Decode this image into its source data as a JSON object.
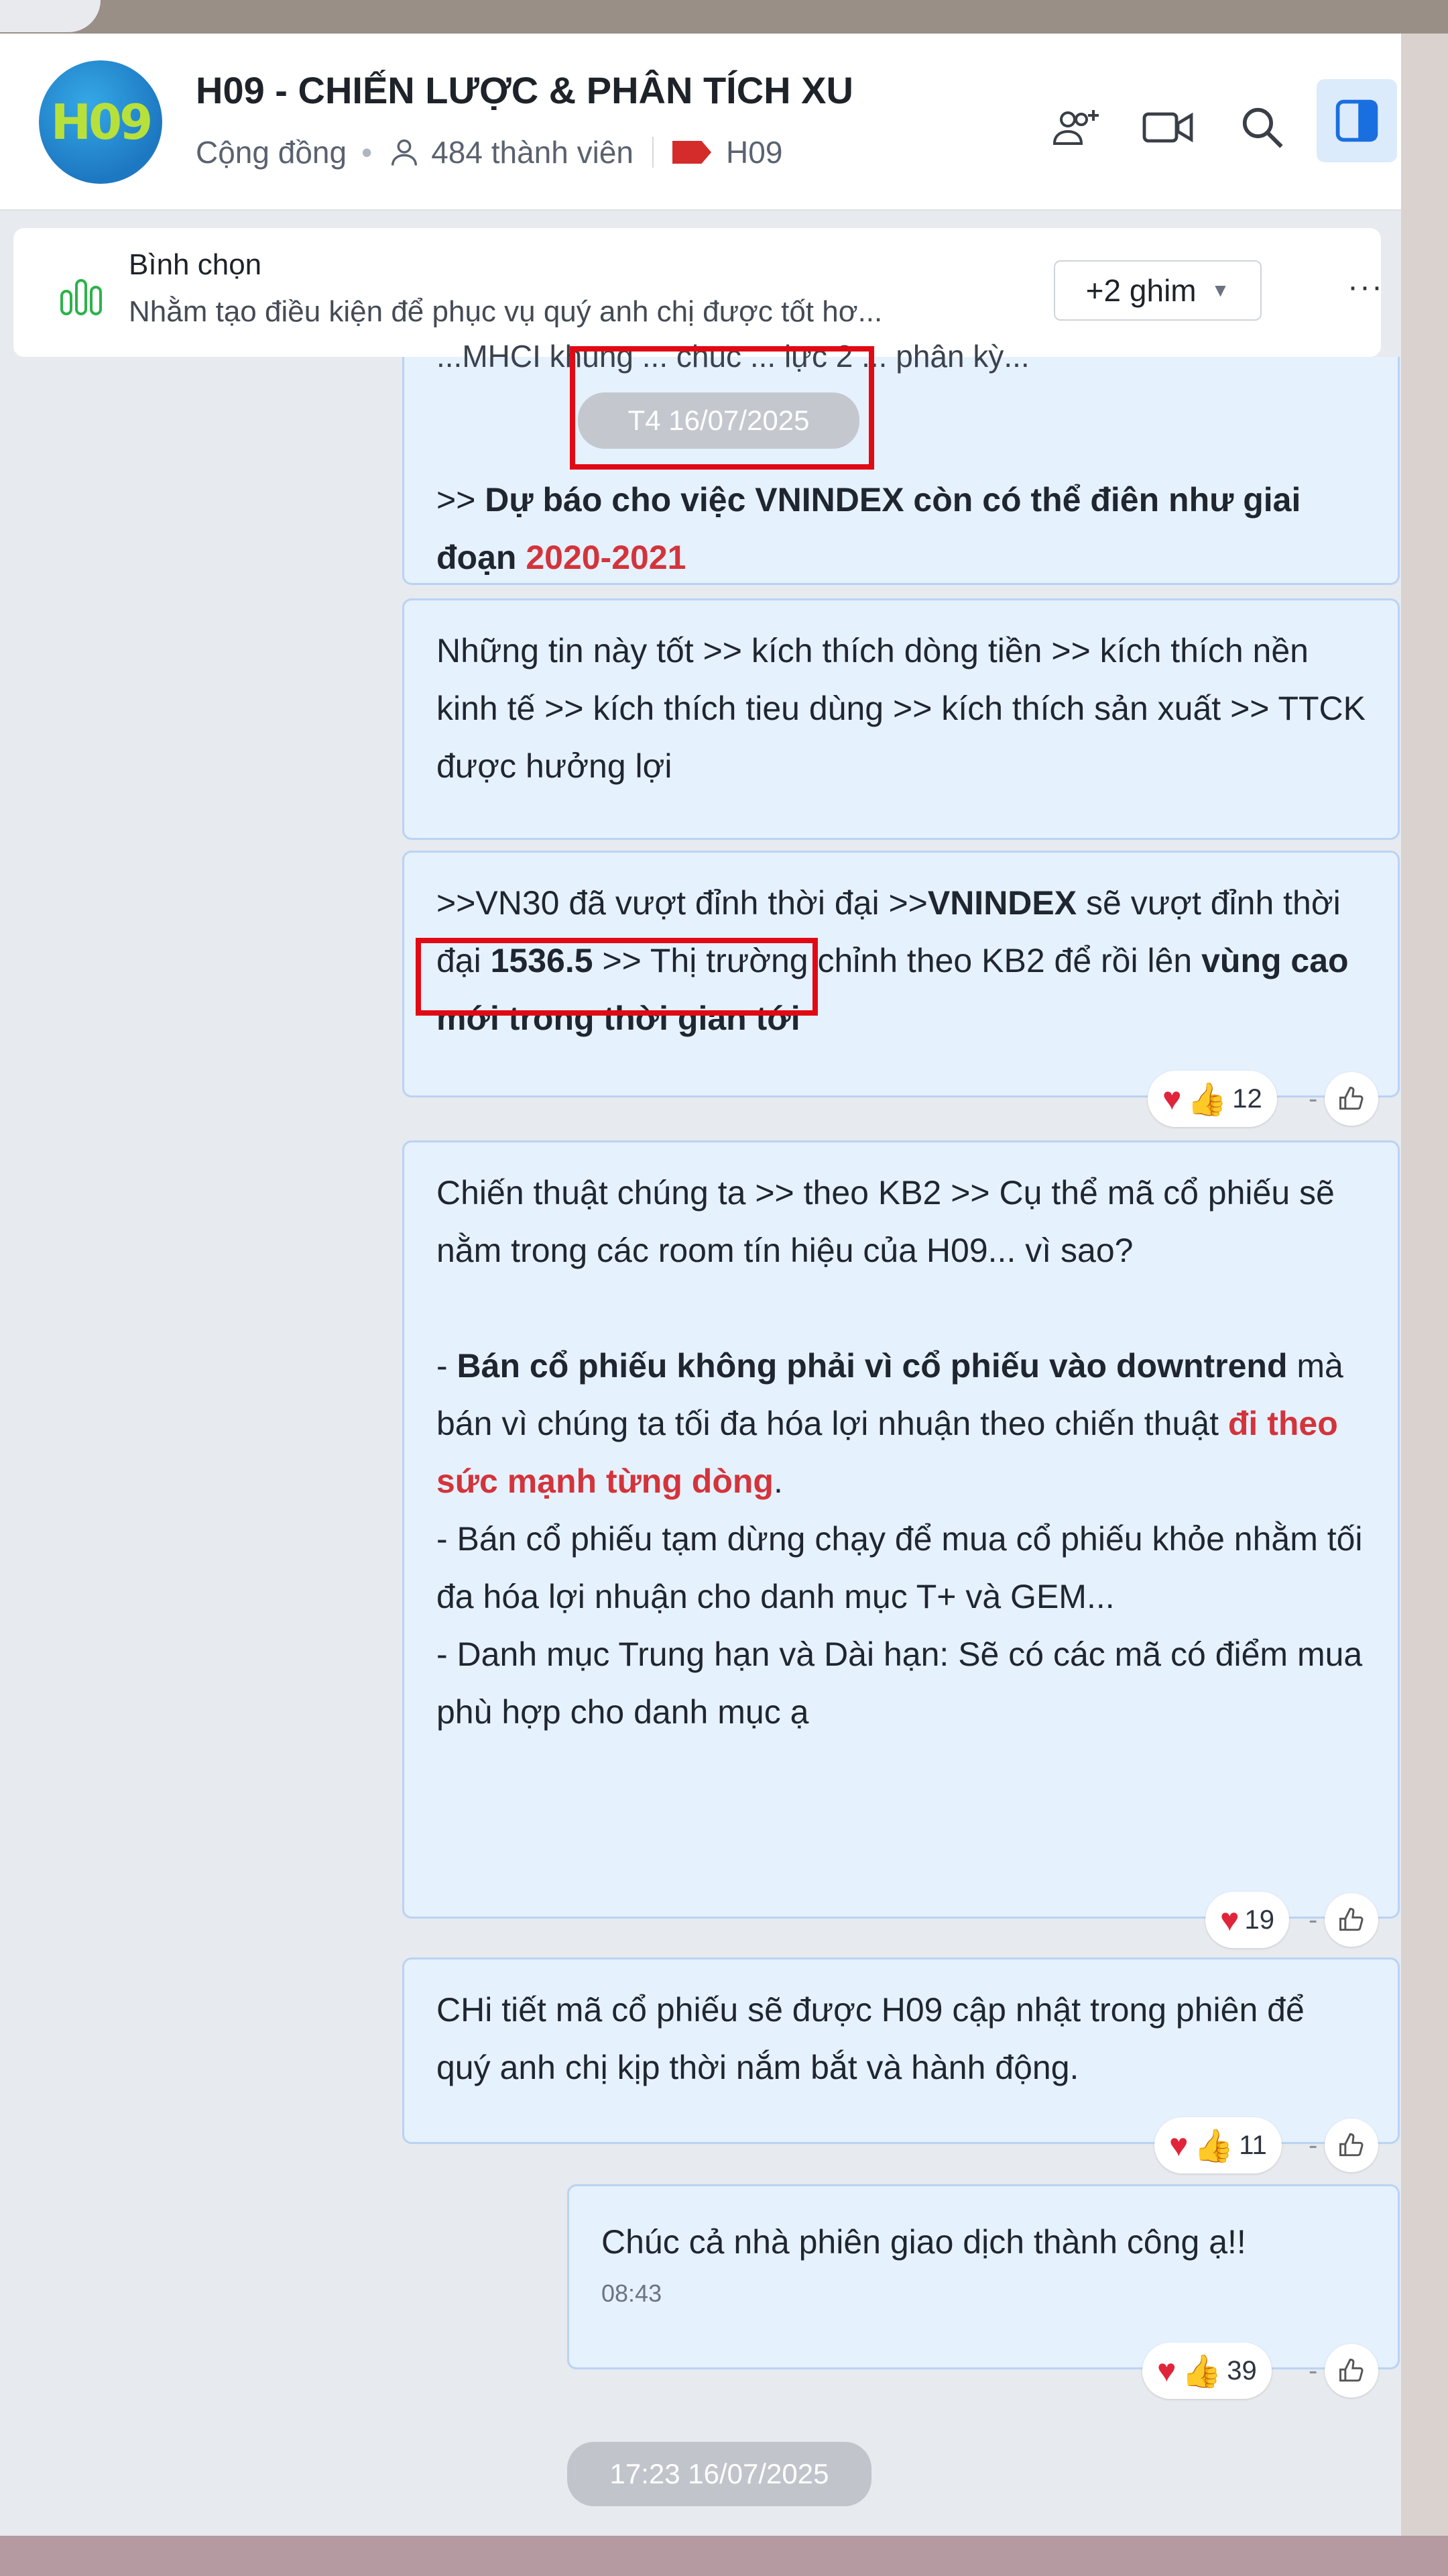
{
  "header": {
    "logo_text": "H09",
    "title": "H09 - CHIẾN LƯỢC & PHÂN TÍCH XU",
    "community": "Cộng đồng",
    "members": "484 thành viên",
    "tag": "H09"
  },
  "pinned": {
    "title": "Bình chọn",
    "preview": "Nhằm tạo điều kiện để phục vụ quý anh chị được tốt hơ...",
    "ghim_label": "+2 ghim",
    "more_label": "···"
  },
  "messages": {
    "m1": {
      "date_chip": "T4 16/07/2025",
      "partial_top": "...MHCI khung ... chuc ... lực 2 ... phân kỳ...",
      "prefix": ">> ",
      "bold": "Dự báo cho việc VNINDEX còn có thể điên như giai đoạn ",
      "red": "2020-2021"
    },
    "m2": {
      "text": "Những tin này tốt >> kích thích dòng tiền >> kích thích nền kinh tế >> kích thích tieu dùng >> kích thích sản xuất >> TTCK được hưởng lợi"
    },
    "m3": {
      "p1": ">>VN30 đã vượt đỉnh thời đại >>",
      "b1": "VNINDEX",
      "p2": " sẽ vượt đỉnh thời đại ",
      "b2": "1536.5",
      "p3": " >> Thị trường chỉnh theo KB2 để rồi lên ",
      "b3": "vùng cao mới trong thời gian tới",
      "reaction_count": "12"
    },
    "m4": {
      "intro": "Chiến thuật chúng ta >> theo KB2 >> Cụ thể mã cổ phiếu sẽ nằm trong các room tín hiệu của H09... vì sao?",
      "l1_prefix": "- ",
      "l1_b1": "Bán cổ phiếu không phải vì cổ phiếu vào downtrend",
      "l1_mid": " mà bán vì chúng ta tối đa hóa lợi nhuận theo chiến thuật ",
      "l1_red": "đi theo sức mạnh từng dòng",
      "l1_end": ".",
      "l2": "- Bán cổ phiếu tạm dừng chạy để mua cổ phiếu khỏe nhằm tối đa hóa lợi nhuận cho danh mục T+ và GEM...",
      "l3": "- Danh mục Trung hạn và Dài hạn: Sẽ có các mã có điểm mua phù hợp cho danh mục ạ",
      "reaction_count": "19"
    },
    "m5": {
      "text": "CHi tiết mã cổ phiếu sẽ được H09 cập nhật trong phiên để quý anh chị kịp thời nắm bắt và hành động.",
      "reaction_count": "11"
    },
    "m6": {
      "text": "Chúc cả nhà phiên giao dịch thành công ạ!!",
      "time": "08:43",
      "reaction_count": "39"
    }
  },
  "bottom_date_chip": "17:23 16/07/2025",
  "colors": {
    "bubble_bg": "#e6f1fe",
    "bubble_border": "#b9d3f3",
    "highlight_red": "#d3343b",
    "annotation_red": "#e10a14"
  }
}
